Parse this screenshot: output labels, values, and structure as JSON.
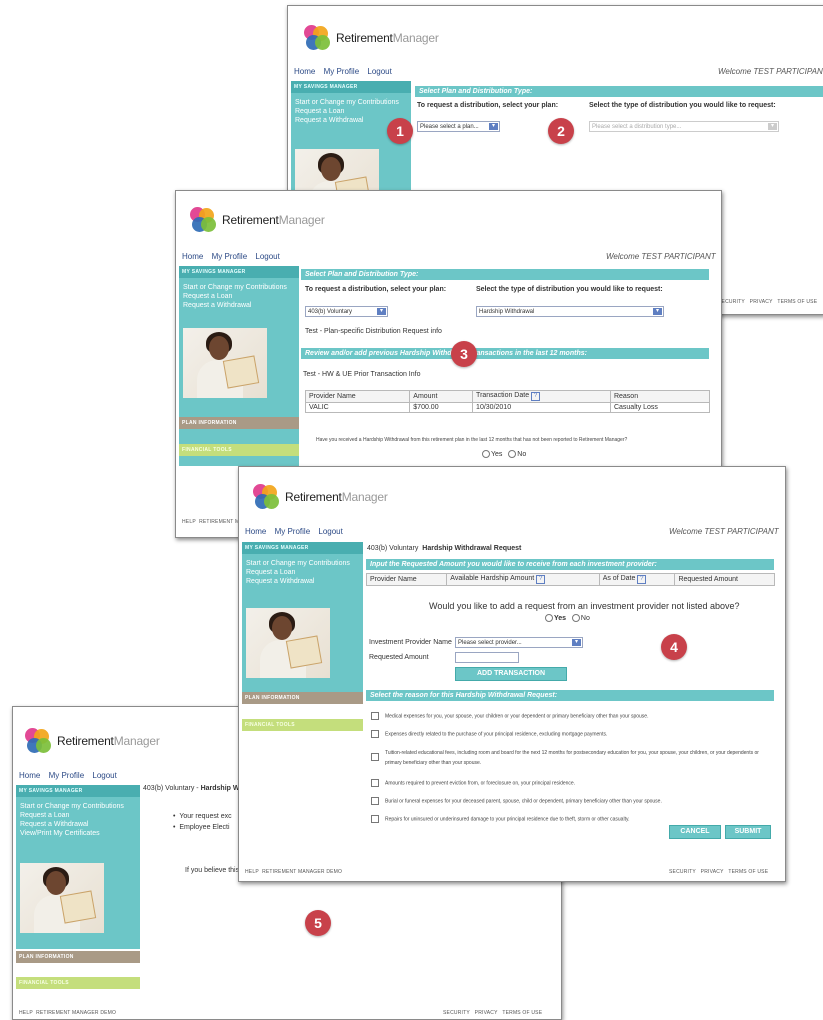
{
  "brand": {
    "name_dark": "Retirement",
    "name_light": "Manager"
  },
  "nav": {
    "home": "Home",
    "profile": "My Profile",
    "logout": "Logout"
  },
  "welcome": "Welcome TEST PARTICIPANT",
  "sidebar": {
    "header": "MY SAVINGS MANAGER",
    "items": [
      "Start or Change my Contributions",
      "Request a Loan",
      "Request a Withdrawal",
      "View/Print My Certificates"
    ],
    "plan_info": "PLAN INFORMATION",
    "financial_tools": "FINANCIAL TOOLS"
  },
  "footer": {
    "help": "HELP",
    "demo": "RETIREMENT MANAGER DEMO",
    "security": "SECURITY",
    "privacy": "PRIVACY",
    "terms": "TERMS OF USE"
  },
  "screen1": {
    "section_title": "Select Plan and Distribution Type:",
    "plan_label": "To request a distribution, select your plan:",
    "type_label": "Select the type of distribution you would like to request:",
    "plan_select": "Please select a plan...",
    "type_select": "Please select a distribution type..."
  },
  "screen2": {
    "section_title": "Select Plan and Distribution Type:",
    "plan_label": "To request a distribution, select your plan:",
    "type_label": "Select the type of distribution you would like to request:",
    "plan_select": "403(b) Voluntary",
    "type_select": "Hardship Withdrawal",
    "plan_info": "Test - Plan-specific Distribution Request info",
    "review_title": "Review and/or add previous Hardship Withdrawal transactions in the last 12 months:",
    "prior_info": "Test - HW & UE Prior Transaction Info",
    "table": {
      "headers": [
        "Provider Name",
        "Amount",
        "Transaction Date",
        "Reason"
      ],
      "rows": [
        [
          "VALIC",
          "$700.00",
          "10/30/2010",
          "Casualty Loss"
        ]
      ]
    },
    "question": "Have you received a Hardship Withdrawal from this retirement plan in the last 12 months that has not been reported to Retirement Manager?",
    "yes": "Yes",
    "no": "No"
  },
  "screen3": {
    "plan": "403(b) Voluntary",
    "request_title": "Hardship Withdrawal Request",
    "input_title": "Input the Requested Amount you would like to receive from each investment provider:",
    "table_headers": [
      "Provider Name",
      "Available Hardship Amount",
      "As of Date",
      "Requested Amount"
    ],
    "add_question": "Would you like to add a request from an investment provider not listed above?",
    "yes": "Yes",
    "no": "No",
    "provider_label": "Investment Provider Name",
    "provider_select": "Please select provider...",
    "amount_label": "Requested Amount",
    "add_button": "ADD TRANSACTION",
    "reason_title": "Select the reason for this Hardship Withdrawal Request:",
    "reasons": [
      "Medical expenses for you, your spouse, your children or your dependent or primary beneficiary other than your spouse.",
      "Expenses directly related to the purchase of your principal residence, excluding mortgage payments.",
      "Tuition-related educational fees, including room and board for the next 12 months for postsecondary education for you, your spouse, your children, or your dependents or primary beneficiary other than your spouse.",
      "Amounts required to prevent eviction from, or foreclosure on, your principal residence.",
      "Burial or funeral expenses for your deceased parent, spouse, child or dependent, primary beneficiary other than your spouse.",
      "Repairs for uninsured or underinsured damage to your principal residence due to theft, storm or other casualty."
    ],
    "cancel": "CANCEL",
    "submit": "SUBMIT"
  },
  "screen4": {
    "plan": "403(b) Voluntary - ",
    "title_partial": "Hardship W",
    "bullets": [
      "Your request exc",
      "Employee Electi"
    ],
    "note": "If you believe this L"
  },
  "badges": [
    "1",
    "2",
    "3",
    "4",
    "5"
  ],
  "colors": {
    "teal": "#6cc6c7",
    "badge": "#c8414a",
    "link": "#2c4a86"
  }
}
